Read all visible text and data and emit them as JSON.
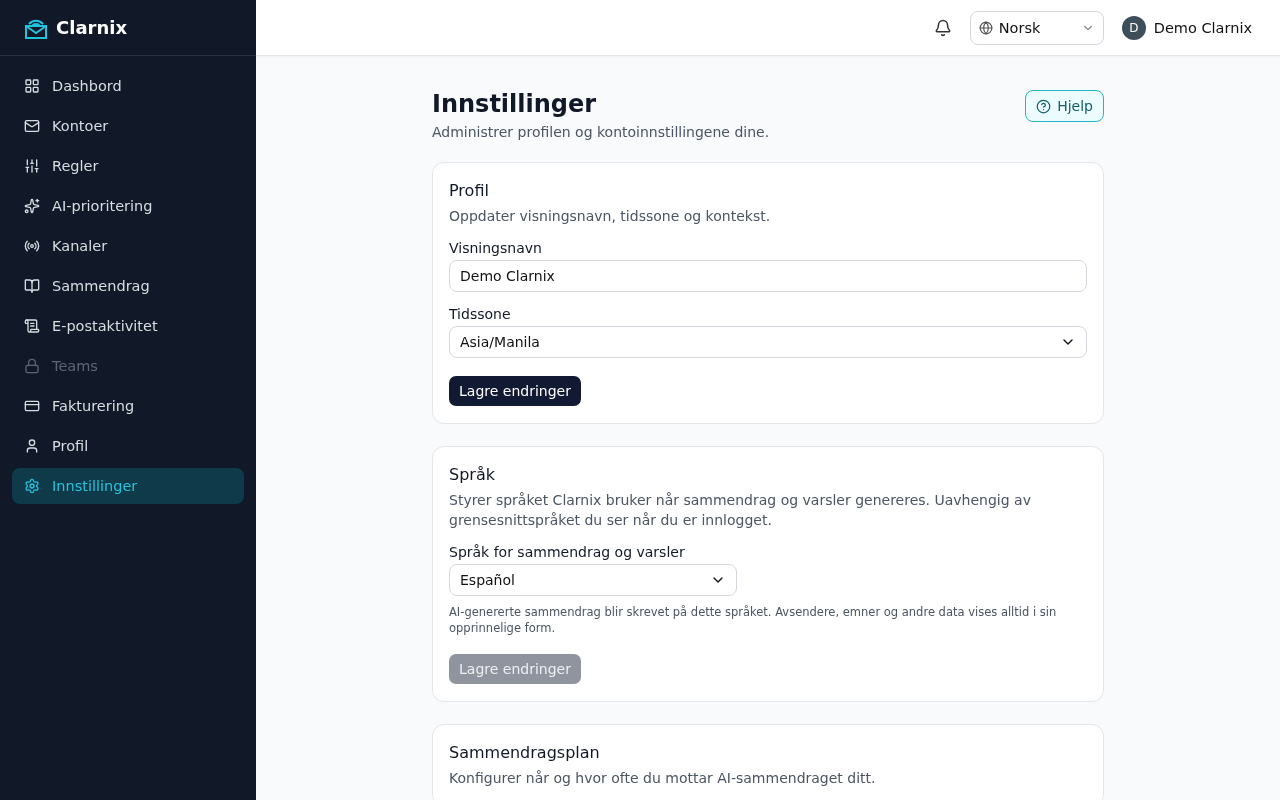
{
  "sidebar": {
    "brand": "Clarnix",
    "items": [
      {
        "label": "Dashbord",
        "selected": false,
        "disabled": false
      },
      {
        "label": "Kontoer",
        "selected": false,
        "disabled": false
      },
      {
        "label": "Regler",
        "selected": false,
        "disabled": false
      },
      {
        "label": "AI-prioritering",
        "selected": false,
        "disabled": false
      },
      {
        "label": "Kanaler",
        "selected": false,
        "disabled": false
      },
      {
        "label": "Sammendrag",
        "selected": false,
        "disabled": false
      },
      {
        "label": "E-postaktivitet",
        "selected": false,
        "disabled": false
      },
      {
        "label": "Teams",
        "selected": false,
        "disabled": true
      },
      {
        "label": "Fakturering",
        "selected": false,
        "disabled": false
      },
      {
        "label": "Profil",
        "selected": false,
        "disabled": false
      },
      {
        "label": "Innstillinger",
        "selected": true,
        "disabled": false
      }
    ]
  },
  "header": {
    "language": "Norsk",
    "user": {
      "initial": "D",
      "name": "Demo Clarnix"
    }
  },
  "page": {
    "title": "Innstillinger",
    "subtitle": "Administrer profilen og kontoinnstillingene dine.",
    "help_button": "Hjelp"
  },
  "cards": [
    {
      "title": "Profil",
      "description": "Oppdater visningsnavn, tidssone og kontekst.",
      "fields": [
        {
          "kind": "text",
          "label": "Visningsnavn",
          "value": "Demo Clarnix"
        },
        {
          "kind": "select",
          "label": "Tidssone",
          "value": "Asia/Manila"
        }
      ],
      "save_button": {
        "label": "Lagre endringer",
        "disabled": false
      }
    },
    {
      "title": "Språk",
      "description": "Styrer språket Clarnix bruker når sammendrag og varsler genereres. Uavhengig av grensesnittspråket du ser når du er innlogget.",
      "fields": [
        {
          "kind": "compact_select",
          "label": "Språk for sammendrag og varsler",
          "value": "Español",
          "hint": "AI-genererte sammendrag blir skrevet på dette språket. Avsendere, emner og andre data vises alltid i sin opprinnelige form."
        }
      ],
      "save_button": {
        "label": "Lagre endringer",
        "disabled": true
      }
    },
    {
      "title": "Sammendragsplan",
      "description": "Konfigurer når og hvor ofte du mottar AI-sammendraget ditt."
    }
  ]
}
